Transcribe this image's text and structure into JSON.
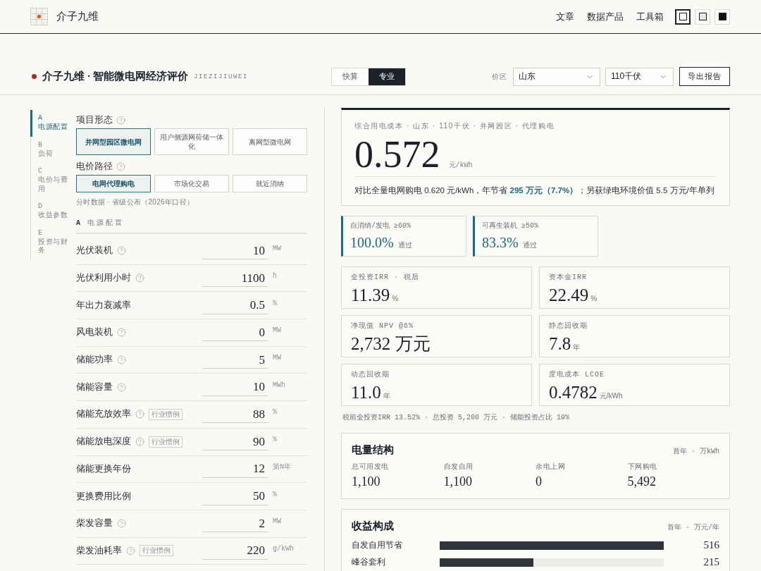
{
  "header": {
    "brand": "介子九维",
    "nav": [
      {
        "label": "文章"
      },
      {
        "label": "数据产品"
      },
      {
        "label": "工具箱"
      }
    ],
    "themes": [
      {
        "color": "#ffffff",
        "selected": true
      },
      {
        "color": "#ede6da",
        "selected": false
      },
      {
        "color": "#111111",
        "selected": false
      }
    ]
  },
  "toolbar": {
    "title": "介子九维 · 智能微电网经济评价",
    "subtitle": "JIEZIJIUWEI",
    "modes": [
      {
        "label": "快算",
        "selected": false
      },
      {
        "label": "专业",
        "selected": true
      }
    ],
    "region_label": "价区",
    "selects": [
      {
        "value": "山东"
      },
      {
        "value": "110千伏"
      }
    ],
    "export_button": "导出报告"
  },
  "steps": [
    {
      "letter": "A",
      "label": "电源配置",
      "selected": true
    },
    {
      "letter": "B",
      "label": "负荷",
      "selected": false
    },
    {
      "letter": "C",
      "label": "电价与费用",
      "selected": false
    },
    {
      "letter": "D",
      "label": "收益参数",
      "selected": false
    },
    {
      "letter": "E",
      "label": "投资与财务",
      "selected": false
    }
  ],
  "form": {
    "groups": [
      {
        "label": "项目形态",
        "help": true,
        "options": [
          {
            "label": "并网型园区微电网",
            "selected": true
          },
          {
            "label": "用户侧源网荷储一体化",
            "selected": false
          },
          {
            "label": "离网型微电网",
            "selected": false
          }
        ]
      },
      {
        "label": "电价路径",
        "help": true,
        "options": [
          {
            "label": "电网代理购电",
            "selected": true
          },
          {
            "label": "市场化交易",
            "selected": false
          },
          {
            "label": "就近消纳",
            "selected": false
          }
        ],
        "note": "分时数据 · 省级公布（2026年口径）"
      }
    ],
    "section": {
      "letter": "A",
      "title": "电源配置",
      "rows": [
        {
          "label": "光伏装机",
          "help": true,
          "value": "10",
          "unit": "MW"
        },
        {
          "label": "光伏利用小时",
          "help": true,
          "value": "1100",
          "unit": "h"
        },
        {
          "label": "年出力衰减率",
          "help": false,
          "value": "0.5",
          "unit": "%"
        },
        {
          "label": "风电装机",
          "help": true,
          "value": "0",
          "unit": "MW"
        },
        {
          "label": "储能功率",
          "help": true,
          "value": "5",
          "unit": "MW"
        },
        {
          "label": "储能容量",
          "help": true,
          "value": "10",
          "unit": "MWh"
        },
        {
          "label": "储能充放效率",
          "help": true,
          "tag": "行业惯例",
          "value": "88",
          "unit": "%"
        },
        {
          "label": "储能放电深度",
          "help": true,
          "tag": "行业惯例",
          "value": "90",
          "unit": "%"
        },
        {
          "label": "储能更换年份",
          "help": false,
          "value": "12",
          "unit": "第N年"
        },
        {
          "label": "更换费用比例",
          "help": false,
          "value": "50",
          "unit": "%"
        },
        {
          "label": "柴发容量",
          "help": true,
          "value": "2",
          "unit": "MW"
        },
        {
          "label": "柴发油耗率",
          "help": true,
          "tag": "行业惯例",
          "value": "220",
          "unit": "g/kWh"
        }
      ]
    }
  },
  "summary": {
    "caption": "综合用电成本 · 山东 · 110千伏 · 并网园区 · 代理购电",
    "value": "0.572",
    "unit": "元/kWh",
    "comparison": "对比全量电网购电 0.620 元/kWh，年节省 **295 万元（7.7%）**；另获绿电环境价值 5.5 万元/年单列"
  },
  "checks": [
    {
      "label": "自消纳/发电 ≥60%",
      "value": "100.0%",
      "status": "通过",
      "passed": true
    },
    {
      "label": "可再生装机 ≥50%",
      "value": "83.3%",
      "status": "通过",
      "passed": true
    }
  ],
  "kpis": [
    {
      "label": "全投资IRR · 税后",
      "value": "11.39",
      "unit": "%"
    },
    {
      "label": "资本金IRR",
      "value": "22.49",
      "unit": "%"
    },
    {
      "label": "净现值 NPV @6%",
      "value": "2,732 万元"
    },
    {
      "label": "静态回收期",
      "value": "7.8",
      "unit": "年"
    },
    {
      "label": "动态回收期",
      "value": "11.0",
      "unit": "年"
    },
    {
      "label": "度电成本 LCOE",
      "value": "0.4782",
      "unit": "元/kWh"
    }
  ],
  "kpi_note": "税前全投资IRR 13.52% · 总投资 5,200 万元 · 储能投资占比 19%",
  "energy": {
    "title": "电量结构",
    "meta": "首年 · 万kWh",
    "items": [
      {
        "label": "总可用发电",
        "value": "1,100"
      },
      {
        "label": "自发自用",
        "value": "1,100"
      },
      {
        "label": "余电上网",
        "value": "0"
      },
      {
        "label": "下网购电",
        "value": "5,492"
      }
    ]
  },
  "revenue": {
    "title": "收益构成",
    "meta": "首年 · 万元/年",
    "items": [
      {
        "label": "自发自用节省",
        "level": 1.0,
        "value": "516"
      },
      {
        "label": "峰谷套利",
        "level": 0.417,
        "value": "215"
      }
    ]
  }
}
